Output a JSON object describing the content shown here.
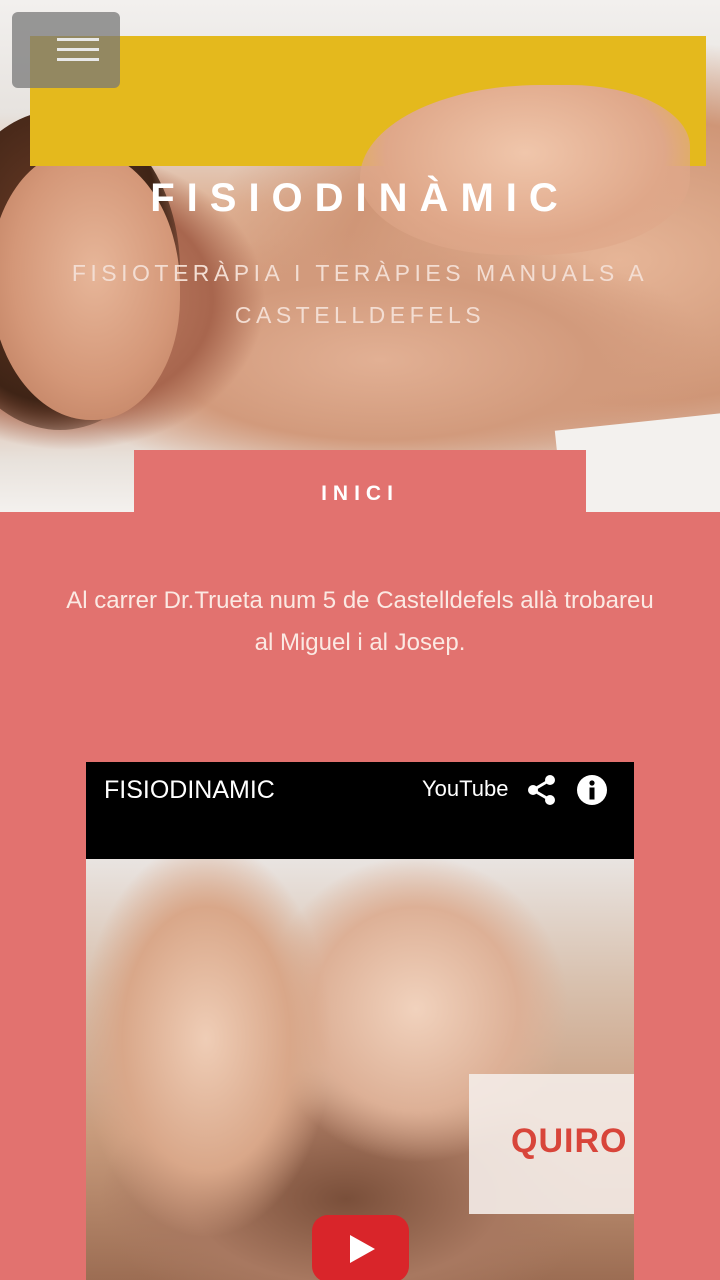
{
  "header": {
    "title": "FISIODINÀMIC",
    "subtitle": "FISIOTERÀPIA I TERÀPIES MANUALS A CASTELLDEFELS"
  },
  "nav": {
    "active_tab": "INICI"
  },
  "intro": {
    "text": "Al carrer Dr.Trueta num 5 de Castelldefels allà trobareu al Miguel i al Josep."
  },
  "video": {
    "title": "FISIODINAMIC",
    "platform": "YouTube",
    "thumbnail_text": "QUIRO",
    "icons": [
      "share-icon",
      "info-icon",
      "play-icon"
    ]
  },
  "colors": {
    "page_background": "#e2726f",
    "accent_yellow": "#e4b91d",
    "play_red": "#d9252a"
  }
}
